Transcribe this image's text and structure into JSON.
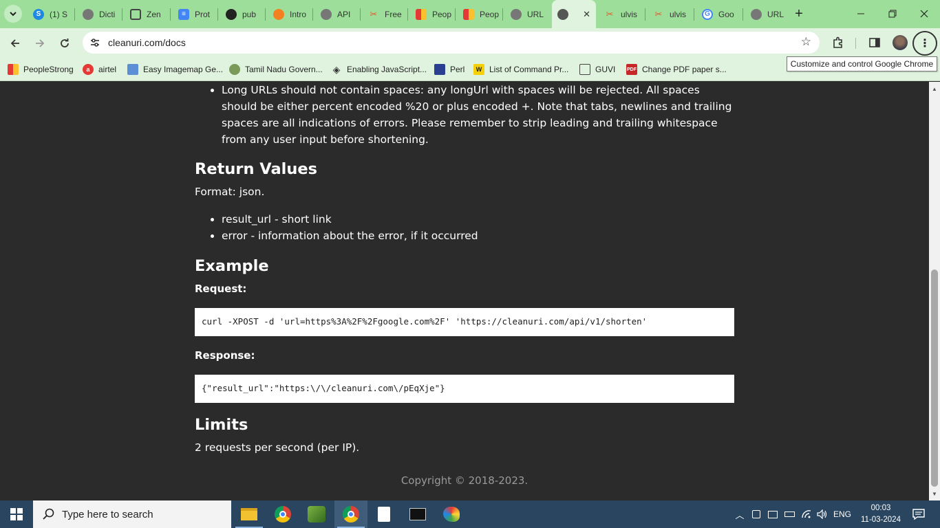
{
  "browser": {
    "tabs": [
      {
        "title": "(1) S",
        "icon": "skype-icon",
        "color": "#1e88e5"
      },
      {
        "title": "Dicti",
        "icon": "globe-icon",
        "color": "#666666"
      },
      {
        "title": "Zen",
        "icon": "list-icon",
        "color": "#444444"
      },
      {
        "title": "Prot",
        "icon": "docs-icon",
        "color": "#4285f4"
      },
      {
        "title": "pub",
        "icon": "github-icon",
        "color": "#222222"
      },
      {
        "title": "Intro",
        "icon": "codepen-icon",
        "color": "#f4801f"
      },
      {
        "title": "API",
        "icon": "globe-icon",
        "color": "#666666"
      },
      {
        "title": "Free",
        "icon": "scissors-icon",
        "color": "#e4572e"
      },
      {
        "title": "Peop",
        "icon": "peoplestrong-icon",
        "color": "#f2994a"
      },
      {
        "title": "Peop",
        "icon": "peoplestrong-icon",
        "color": "#f2994a"
      },
      {
        "title": "URL",
        "icon": "globe-icon",
        "color": "#666666"
      },
      {
        "title": "",
        "icon": "globe-icon",
        "color": "#666666",
        "active": true
      },
      {
        "title": "ulvis",
        "icon": "scissors-icon",
        "color": "#e4572e"
      },
      {
        "title": "ulvis",
        "icon": "scissors-icon",
        "color": "#e4572e"
      },
      {
        "title": "Goo",
        "icon": "google-icon",
        "color": "#4285f4"
      },
      {
        "title": "URL",
        "icon": "globe-icon",
        "color": "#666666"
      }
    ],
    "close_glyph": "✕",
    "new_tab_glyph": "+",
    "address": "cleanuri.com/docs",
    "tooltip": "Customize and control Google Chrome",
    "bookmarks": [
      {
        "label": "PeopleStrong",
        "icon": "peoplestrong-icon"
      },
      {
        "label": "airtel",
        "icon": "airtel-icon"
      },
      {
        "label": "Easy Imagemap Ge...",
        "icon": "imagemap-icon"
      },
      {
        "label": "Tamil Nadu Govern...",
        "icon": "tn-emblem-icon"
      },
      {
        "label": "Enabling JavaScript...",
        "icon": "diamond-icon"
      },
      {
        "label": "Perl",
        "icon": "perl-icon"
      },
      {
        "label": "List of Command Pr...",
        "icon": "wiki-icon"
      },
      {
        "label": "GUVI",
        "icon": "folder-icon"
      },
      {
        "label": "Change PDF paper s...",
        "icon": "pdf-icon"
      }
    ]
  },
  "doc": {
    "top_bullet": "Long URLs should not contain spaces: any longUrl with spaces will be rejected. All spaces should be either percent encoded %20 or plus encoded +. Note that tabs, newlines and trailing spaces are all indications of errors. Please remember to strip leading and trailing whitespace from any user input before shortening.",
    "return_values_heading": "Return Values",
    "format_text": "Format: json.",
    "return_items": [
      "result_url - short link",
      "error - information about the error, if it occurred"
    ],
    "example_heading": "Example",
    "request_label": "Request:",
    "request_code": "curl -XPOST -d 'url=https%3A%2F%2Fgoogle.com%2F' 'https://cleanuri.com/api/v1/shorten'",
    "response_label": "Response:",
    "response_code": "{\"result_url\":\"https:\\/\\/cleanuri.com\\/pEqXje\"}",
    "limits_heading": "Limits",
    "limits_text": "2 requests per second (per IP).",
    "copyright": "Copyright © 2018-2023."
  },
  "taskbar": {
    "search_placeholder": "Type here to search",
    "language": "ENG",
    "time": "00:03",
    "date": "11-03-2024",
    "apps": [
      "file-explorer-icon",
      "chrome-icon",
      "game-app-icon",
      "chrome-profile-icon",
      "notepad-icon",
      "terminal-icon",
      "paint-icon"
    ]
  }
}
